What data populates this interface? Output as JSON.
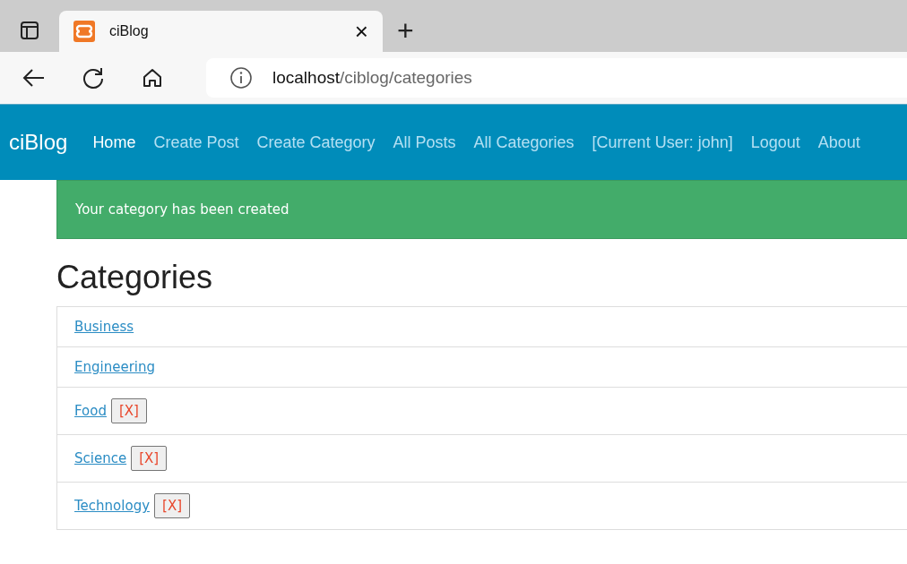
{
  "browser": {
    "tab_title": "ciBlog",
    "tab_close": "×",
    "new_tab": "+",
    "address_host": "localhost",
    "address_path": "/ciblog/categories"
  },
  "navbar": {
    "brand": "ciBlog",
    "items": [
      {
        "label": "Home",
        "selected": true
      },
      {
        "label": "Create Post",
        "selected": false
      },
      {
        "label": "Create Category",
        "selected": false
      },
      {
        "label": "All Posts",
        "selected": false
      },
      {
        "label": "All Categories",
        "selected": false
      },
      {
        "label": "[Current User: john]",
        "selected": false
      },
      {
        "label": "Logout",
        "selected": false
      },
      {
        "label": "About",
        "selected": false
      }
    ]
  },
  "alert": {
    "message": "Your category has been created"
  },
  "heading": "Categories",
  "categories": [
    {
      "name": "Business"
    },
    {
      "name": "Engineering"
    },
    {
      "name": "Food",
      "delete": "[X]"
    },
    {
      "name": "Science",
      "delete": "[X]"
    },
    {
      "name": "Technology",
      "delete": "[X]"
    }
  ]
}
